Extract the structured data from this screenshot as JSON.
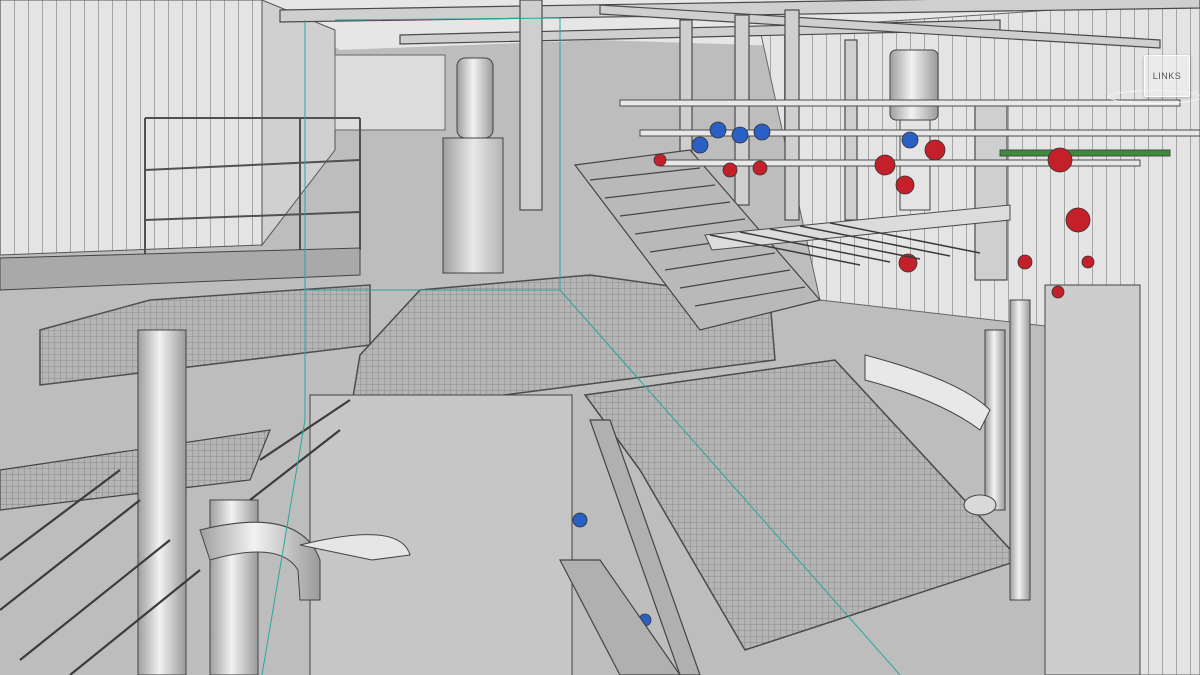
{
  "viewer": {
    "nav_button_label": "LINKS"
  },
  "colors": {
    "wall": "#d9d9d9",
    "steel": "#bfbfbf",
    "grating": "#a9a9a9",
    "pipe": "#e6e6e6",
    "valve_red": "#c4202a",
    "valve_blue": "#2a5fc4",
    "pipe_green": "#3c8c3c",
    "section_line": "#2aa6a0"
  }
}
